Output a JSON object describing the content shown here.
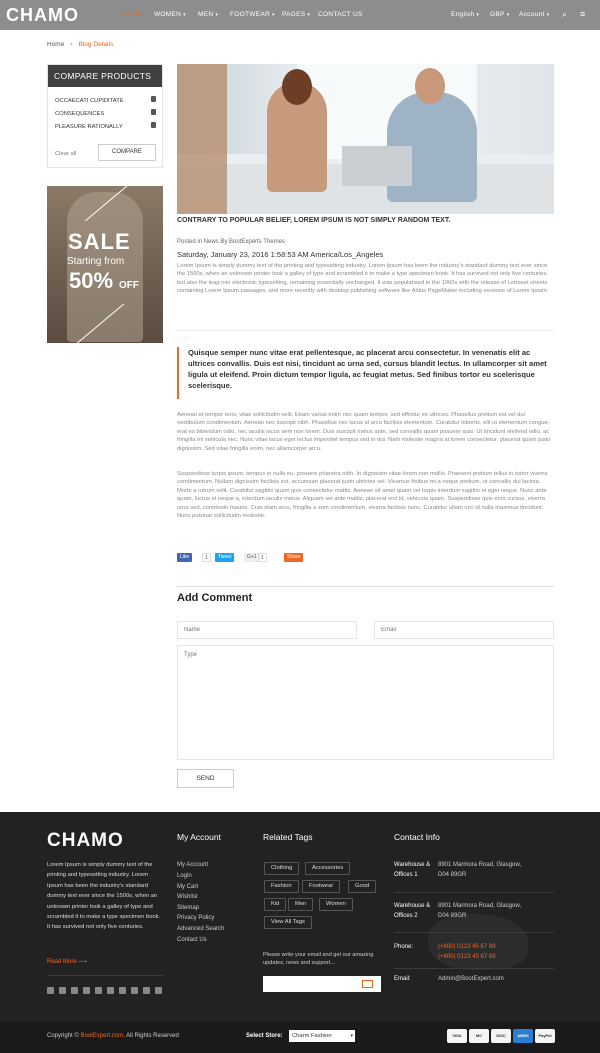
{
  "header": {
    "logo": "CHAMO",
    "nav": [
      "HOME",
      "WOMEN",
      "MEN",
      "FOOTWEAR",
      "PAGES",
      "CONTACT US"
    ],
    "right": [
      "English",
      "GBP",
      "Account"
    ]
  },
  "breadcrumb": {
    "home": "Home",
    "current": "Blog Details"
  },
  "compare": {
    "title": "COMPARE PRODUCTS",
    "items": [
      "OCCAECATI CUPIDITATE",
      "CONSEQUENCES",
      "PLEASURE RATIONALLY"
    ],
    "clear": "Clear all",
    "button": "COMPARE"
  },
  "banner": {
    "sale": "SALE",
    "starting": "Starting from",
    "percent": "50%",
    "off": "OFF"
  },
  "post": {
    "title": "CONTRARY TO POPULAR BELIEF, LOREM IPSUM IS NOT SIMPLY RANDOM TEXT.",
    "meta": "Posted in News By BootExperts Themes",
    "date": "Saturday, January 23, 2016 1:58:53 AM America/Los_Angeles",
    "intro": "Lorem Ipsum is simply dummy text of the printing and typesetting industry. Lorem Ipsum has been the industry's standard dummy text ever since the 1500s, when an unknown printer took a galley of type and scrambled it to make a type specimen book. It has survived not only five centuries, but also the leap into electronic typesetting, remaining essentially unchanged. It was popularised in the 1960s with the release of Letraset sheets containing Lorem Ipsum passages, and more recently with desktop publishing software like Aldus PageMaker including versions of Lorem Ipsum.",
    "quote": "Quisque semper nunc vitae erat pellentesque, ac placerat arcu consectetur. In venenatis elit ac ultrices convallis. Duis est nisi, tincidunt ac urna sed, cursus blandit lectus. In ullamcorper sit amet ligula ut eleifend. Proin dictum tempor ligula, ac feugiat metus. Sed finibus tortor eu scelerisque scelerisque.",
    "body1": "Aenean et tempor eros, vitae sollicitudin velit. Etiam varius enim nec quam tempor, sed efficitur ex ultrices. Phasellus pretium est vel dui vestibulum condimentum. Aenean nec suscipit nibh. Phasellus nec lacus id arcu facilisis elementum. Curabitur lobortis, elit ut elementum congue, erat ex bibendum odio, nec iaculis lacus sem non lorem. Duis suscipit metus ante, sed convallis quam posuere quis. Ut tincidunt eleifend odio, ac fringilla mi vehicula nec. Nunc vitae lacus eget lectus imperdiet tempus sed in dui. Nam molestie magna at lorem consectetur, placerat quam justo dignissim. Sed vitae fringilla enim, nec ullamcorper arcu.",
    "body2": "Suspendisse turpis ipsum, tempus in nulla eu, posuere pharetra nibh. In dignissim vitae lorem non mollis. Praesent pretium tellus in tortor viverra condimentum. Nullam dignissim facilisis est, accumsan placerat justo ultricies vel. Vivamus finibus mi a neque pretium, ut convallis dui lacinia. Morbi a rutrum velit. Curabitur sagittis quam quis consectetur mattis. Aenean sit amet quam vel turpis interdum sagittis et eget neque. Nunc ante quam, luctus et neque a, interdum iaculis metus. Aliquam vel ante mattis, placerat orci id, vehicula quam. Suspendisse quis eros cursus, viverra urna sed, commodo mauris. Cras diam arcu, fringilla a sem condimentum, viverra facilisis nunc. Curabitur ullam orci id nulla maximus tincidunt. Nunc pulvinar sollicitudin molestie."
  },
  "share": {
    "like": "Like",
    "like_count": "1",
    "tweet": "Tweet",
    "gplus": "G+1",
    "gplus_count": "1",
    "share": "Share"
  },
  "comment": {
    "title": "Add Comment",
    "name_placeholder": "Name",
    "email_placeholder": "Email",
    "text_placeholder": "Type",
    "send": "SEND"
  },
  "footer": {
    "logo": "CHAMO",
    "about": "Lorem Ipsum is simply dummy text of the printing and typesetting industry. Lorem Ipsum has been the industry's standard dummy text ever since the 1500s, when an unknown printer took a galley of type and scrambled it to make a type specimen book. It has survived not only five centuries.",
    "read_more": "Read More",
    "account_title": "My Account",
    "account_links": [
      "My Account",
      "Login",
      "My Cart",
      "Wishlist",
      "Sitemap",
      "Privacy Policy",
      "Advanced Search",
      "Contact Us"
    ],
    "tags_title": "Related Tags",
    "tags": [
      "Clothing",
      "Accessories",
      "Fashion",
      "Footwear",
      "Good",
      "Kid",
      "Men",
      "Women",
      "View All Tags"
    ],
    "newsletter_text": "Please write your email and get our amazing updates, news and support...",
    "contact_title": "Contact Info",
    "warehouse1_label": "Warehouse & Offices 1",
    "warehouse1_addr1": "8901 Marmora Road, Glasgow,",
    "warehouse1_addr2": "D04 89GR",
    "warehouse2_label": "Warehouse & Offices 2",
    "warehouse2_addr1": "8901 Marmora Road, Glasgow,",
    "warehouse2_addr2": "D04 89GR",
    "phone_label": "Phone:",
    "phone1": "(+800) 0123 45 67 89",
    "phone2": "(+800) 0123 45 67 89",
    "email_label": "Email:",
    "email": "Admin@BootExpert.com"
  },
  "bottom": {
    "copyright_prefix": "Copyright ©",
    "copyright_link": "BootExpert.com",
    "copyright_suffix": ". All Rights Reserved",
    "store_label": "Select Store:",
    "store_value": "Charm Fashion",
    "payments": [
      "VISA",
      "MC",
      "DISC",
      "AMEX",
      "PayPal"
    ]
  },
  "colors": {
    "accent": "#f26522",
    "topbar": "#8d8d8d",
    "footer": "#222222"
  }
}
